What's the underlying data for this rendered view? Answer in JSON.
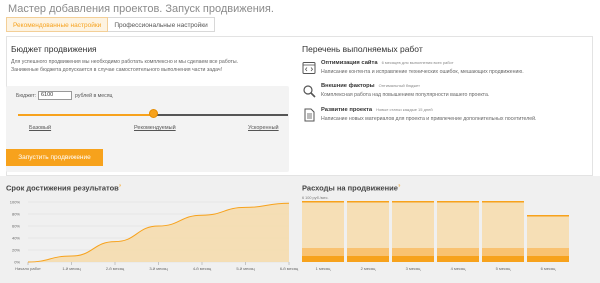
{
  "title": "Мастер добавления проектов. Запуск продвижения.",
  "tabs": [
    {
      "label": "Рекомендованные настройки",
      "active": true
    },
    {
      "label": "Профессиональные настройки",
      "active": false
    }
  ],
  "budget": {
    "heading": "Бюджет продвижения",
    "desc_line1": "Для успешного продвижения мы необходимо работать комплексно и мы сделаем все работы.",
    "desc_line2": "Заниженые бюджета допускается в случае самостоятельного выполнения части задач!",
    "label": "Бюджет:",
    "value": "6100",
    "unit": "рублей в месяц",
    "slider_position": 0.5,
    "stops": [
      "Базовый",
      "Рекомендуемый",
      "Ускоренный"
    ]
  },
  "works": {
    "heading": "Перечень выполняемых работ",
    "items": [
      {
        "icon": "code-icon",
        "title": "Оптимизация сайта",
        "note": "6 месяцев для выполнения всех работ",
        "desc": "Написание контента и исправление технических ошибок, мешающих продвижению."
      },
      {
        "icon": "search-icon",
        "title": "Внешние факторы",
        "note": "Оптимальный бюджет",
        "desc": "Комплексная работа над повышением популярности вашего проекта."
      },
      {
        "icon": "document-icon",
        "title": "Развитие проекта",
        "note": "Новые статьи каждые 15 дней",
        "desc": "Написание новых материалов для проекта и привлечение дополнительных посетителей."
      }
    ]
  },
  "start_button": "Запустить продвижение",
  "colors": {
    "accent": "#f7a21c",
    "area_fill": "#f5dcae",
    "bar_light": "#f6dfb6",
    "bar_mid": "#f9c271"
  },
  "chart_data": [
    {
      "type": "area",
      "title": "Срок достижения результатов",
      "ylabels": [
        "100%",
        "80%",
        "60%",
        "40%",
        "20%",
        "0%"
      ],
      "ylim": [
        0,
        100
      ],
      "categories": [
        "Начало работ",
        "1-й месяц",
        "2-й месяц",
        "3-й месяц",
        "4-й месяц",
        "5-й месяц",
        "6-й месяц"
      ],
      "values": [
        0,
        10,
        34,
        60,
        78,
        91,
        98
      ]
    },
    {
      "type": "bar",
      "title": "Расходы на продвижение",
      "annotation": "6 100 руб./мес.",
      "categories": [
        "1 месяц",
        "2 месяц",
        "3 месяц",
        "4 месяц",
        "5 месяц",
        "6 месяц"
      ],
      "values": [
        6100,
        6100,
        6100,
        6100,
        6100,
        4700
      ],
      "ylim": [
        0,
        6100
      ]
    }
  ]
}
